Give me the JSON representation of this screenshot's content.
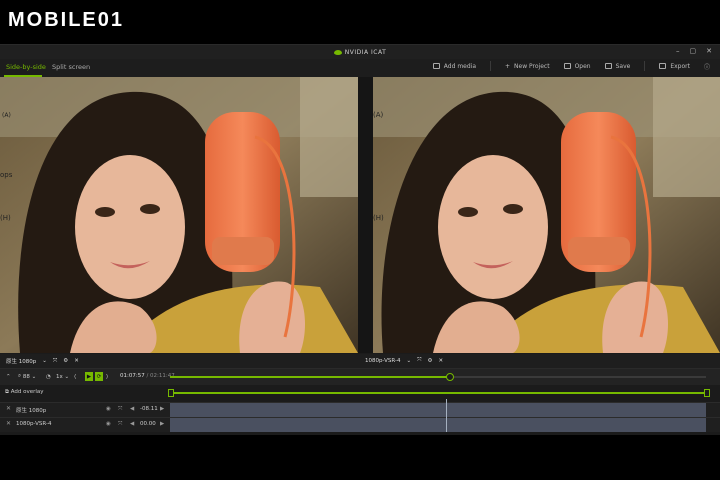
{
  "brand": {
    "text": "MOBILE01"
  },
  "window": {
    "title": "NVIDIA ICAT",
    "controls": [
      "–",
      "▢",
      "✕"
    ]
  },
  "tabs": [
    {
      "label": "Side-by-side",
      "active": true
    },
    {
      "label": "Split screen",
      "active": false
    }
  ],
  "actions": [
    {
      "label": "Add media",
      "icon": "image-add-icon"
    },
    {
      "label": "New Project",
      "icon": "plus-icon"
    },
    {
      "label": "Open",
      "icon": "folder-icon"
    },
    {
      "label": "Save",
      "icon": "save-icon"
    },
    {
      "label": "Export",
      "icon": "export-icon"
    },
    {
      "label": "",
      "icon": "help-icon"
    }
  ],
  "left_pane": {
    "edge_labels": [
      "(A)",
      "ops",
      "(H)"
    ]
  },
  "right_pane": {
    "edge_labels": [
      "(A)",
      "(H)"
    ]
  },
  "pane_labels": {
    "left": "原生 1080p",
    "right": "1080p-VSR-4"
  },
  "controls": {
    "zoom": "88",
    "speed": "1x",
    "timecode_current": "01:07:57",
    "timecode_total": "/ 02:11:47",
    "progress": 0.52
  },
  "overlay": {
    "label": "Add overlay"
  },
  "tracks": [
    {
      "name": "原生 1080p",
      "offset": "-08.11"
    },
    {
      "name": "1080p-VSR-4",
      "offset": "00.00"
    }
  ],
  "colors": {
    "accent": "#76b900",
    "bg": "#1b1b1b"
  }
}
